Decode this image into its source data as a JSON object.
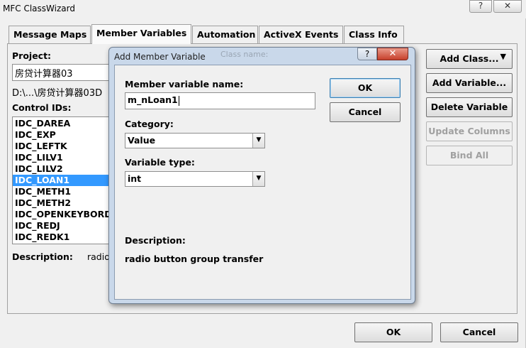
{
  "window": {
    "title": "MFC ClassWizard",
    "help_glyph": "?",
    "close_glyph": "✕"
  },
  "tabs": [
    "Message Maps",
    "Member Variables",
    "Automation",
    "ActiveX Events",
    "Class Info"
  ],
  "main": {
    "project_label": "Project:",
    "project_value": "房贷计算器03",
    "path_text": "D:\\...\\房贷计算器03D",
    "control_ids_label": "Control IDs:",
    "control_ids": [
      "IDC_DAREA",
      "IDC_EXP",
      "IDC_LEFTK",
      "IDC_LILV1",
      "IDC_LILV2",
      "IDC_LOAN1",
      "IDC_METH1",
      "IDC_METH2",
      "IDC_OPENKEYBORD",
      "IDC_REDJ",
      "IDC_REDK1"
    ],
    "selected_control": "IDC_LOAN1",
    "description_label": "Description:",
    "description_value": "radio"
  },
  "right_buttons": {
    "add_class": "Add Class...",
    "add_variable": "Add Variable...",
    "delete_variable": "Delete Variable",
    "update_columns": "Update Columns",
    "bind_all": "Bind All"
  },
  "bottom_buttons": {
    "ok": "OK",
    "cancel": "Cancel"
  },
  "dialog": {
    "title": "Add Member Variable",
    "ghost_text": "Class name:",
    "help_glyph": "?",
    "close_glyph": "✕",
    "member_name_label": "Member variable name:",
    "member_name_value": "m_nLoan1",
    "category_label": "Category:",
    "category_value": "Value",
    "variable_type_label": "Variable type:",
    "variable_type_value": "int",
    "ok_label": "OK",
    "cancel_label": "Cancel",
    "description_label": "Description:",
    "description_value": "radio button group transfer"
  },
  "colors": {
    "selection": "#3399ff",
    "dialog_frame": "#c9d8ea",
    "close_button": "#c7402c",
    "face": "#f0f0f0"
  }
}
